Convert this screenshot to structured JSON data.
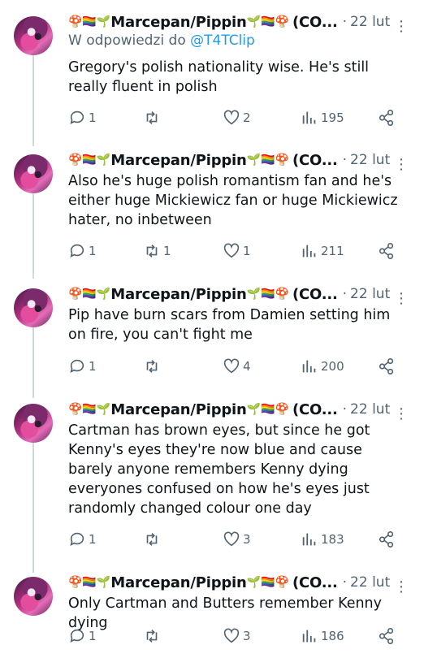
{
  "author": {
    "emoji_prefix": "🍄🏳️‍🌈🌱",
    "name": "Marcepan/Pippin",
    "emoji_suffix": "🌱🏳️‍🌈🍄",
    "handle_truncated": "(CO...",
    "separator": "·"
  },
  "tweets": [
    {
      "time": "22 lut",
      "reply_prefix": "W odpowiedzi do",
      "reply_handle": "@T4TClip",
      "text": "Gregory's polish nationality wise. He's still really fluent in polish",
      "replies": "1",
      "retweets": "",
      "likes": "2",
      "views": "195"
    },
    {
      "time": "22 lut",
      "text": "Also he's huge polish romantism fan and he's either huge Mickiewicz fan or huge Mickiewicz hater, no inbetween",
      "replies": "1",
      "retweets": "1",
      "likes": "1",
      "views": "211"
    },
    {
      "time": "22 lut",
      "text": "Pip have burn scars from Damien setting him on fire, you can't fight me",
      "replies": "1",
      "retweets": "",
      "likes": "4",
      "views": "200"
    },
    {
      "time": "22 lut",
      "text": "Cartman has brown eyes, but since he got Kenny's eyes they're now blue and cause barely anyone remembers Kenny dying everyones confused on how he's eyes just randomly changed colour one day",
      "replies": "1",
      "retweets": "",
      "likes": "3",
      "views": "183"
    },
    {
      "time": "22 lut",
      "text": "Only Cartman and Butters remember Kenny dying",
      "replies": "1",
      "retweets": "",
      "likes": "3",
      "views": "186"
    }
  ],
  "icons": {
    "reply": "reply-icon",
    "retweet": "retweet-icon",
    "like": "heart-icon",
    "views": "views-icon",
    "share": "share-icon",
    "more": "more-icon"
  },
  "colors": {
    "link": "#1d9bf0",
    "muted": "#536471",
    "thread_line": "#cfd9de"
  }
}
